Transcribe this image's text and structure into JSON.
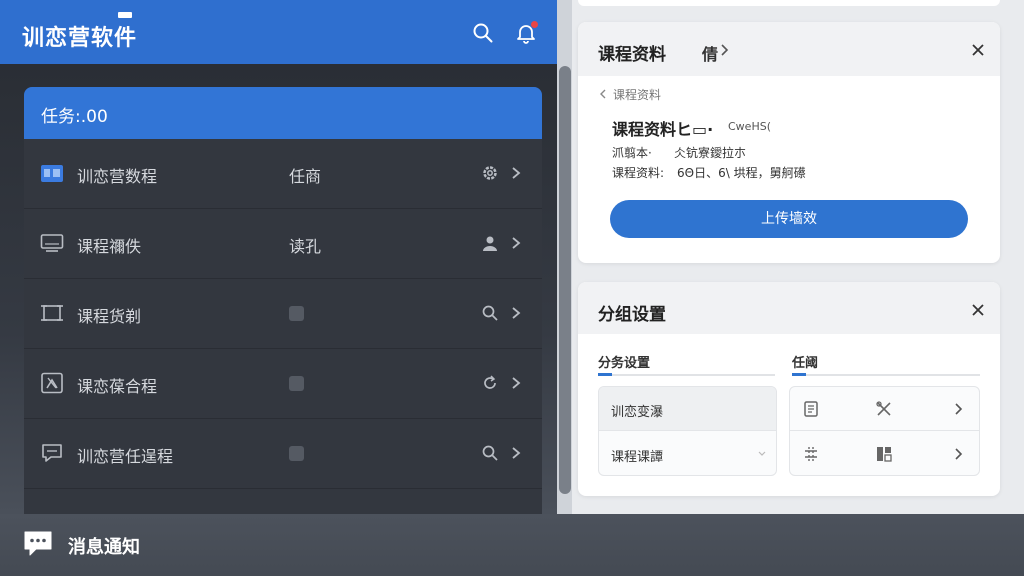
{
  "app": {
    "title": "训恋营软件"
  },
  "header_icons": [
    "search-icon",
    "bell-icon"
  ],
  "task_card": {
    "header": "任务:.00",
    "rows": [
      {
        "label": "训恋营数程",
        "mid": "任商",
        "icon": "calendar-icon",
        "action": "gear-icon"
      },
      {
        "label": "课程禰佚",
        "mid": "读孔",
        "icon": "monitor-icon",
        "action": "user-icon"
      },
      {
        "label": "课程货剃",
        "mid": "",
        "icon": "frame-icon",
        "action": "search-icon"
      },
      {
        "label": "课恋葆合程",
        "mid": "",
        "icon": "image-icon",
        "action": "refresh-icon"
      },
      {
        "label": "训恋营任逞程",
        "mid": "",
        "icon": "chat-icon",
        "action": "search-icon"
      }
    ]
  },
  "course_card": {
    "title": "课程资料",
    "tab": "倩",
    "breadcrumb": "课程资料",
    "item_title": "课程资料ヒ▭·",
    "item_tag": "CweHS(",
    "line1_label": "沠翦本·",
    "line1_value": "仌钪寮鑀拉朩",
    "line2_label": "课程资料:",
    "line2_value": "6Θ日、6\\ 垬程，舅舸礤",
    "button": "上传墙效"
  },
  "group_card": {
    "title": "分组设置",
    "tab_left": "分务设置",
    "tab_right": "任阈",
    "list_items": [
      "训恋变瀑",
      "课程课譚"
    ]
  },
  "bottom": {
    "label": "消息通知"
  },
  "colors": {
    "primary": "#2f6fcf",
    "button": "#2f74d0",
    "dark_bg": "#33373f",
    "notification_dot": "#e84545"
  }
}
